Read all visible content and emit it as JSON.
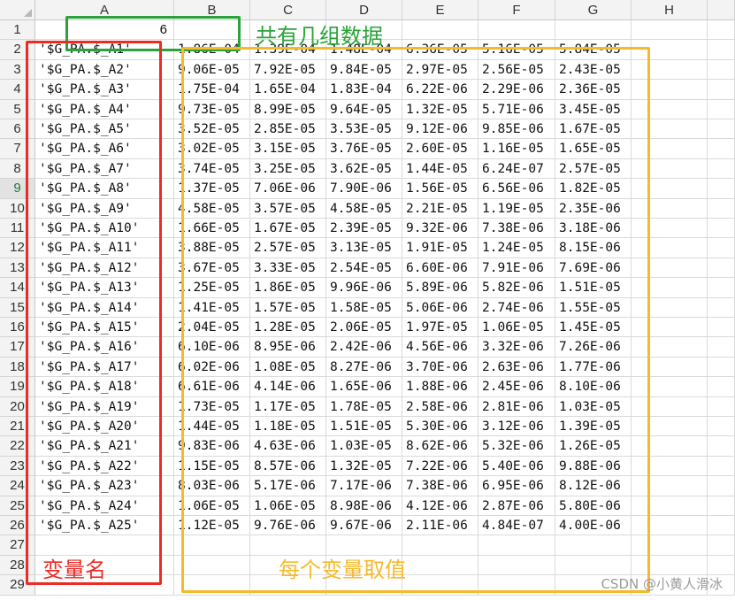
{
  "columns": [
    "A",
    "B",
    "C",
    "D",
    "E",
    "F",
    "G",
    "H"
  ],
  "rows": [
    "1",
    "2",
    "3",
    "4",
    "5",
    "6",
    "7",
    "8",
    "9",
    "10",
    "11",
    "12",
    "13",
    "14",
    "15",
    "16",
    "17",
    "18",
    "19",
    "20",
    "21",
    "22",
    "23",
    "24",
    "25",
    "26",
    "27",
    "28",
    "29"
  ],
  "selected_row": "9",
  "count_cell": "6",
  "data_rows": [
    {
      "name": "'$G_PA.$_A1'",
      "vals": [
        "1.86E-04",
        "1.39E-04",
        "1.48E-04",
        "6.36E-05",
        "5.16E-05",
        "5.84E-05"
      ]
    },
    {
      "name": "'$G_PA.$_A2'",
      "vals": [
        "9.06E-05",
        "7.92E-05",
        "9.84E-05",
        "2.97E-05",
        "2.56E-05",
        "2.43E-05"
      ]
    },
    {
      "name": "'$G_PA.$_A3'",
      "vals": [
        "1.75E-04",
        "1.65E-04",
        "1.83E-04",
        "6.22E-06",
        "2.29E-06",
        "2.36E-05"
      ]
    },
    {
      "name": "'$G_PA.$_A4'",
      "vals": [
        "9.73E-05",
        "8.99E-05",
        "9.64E-05",
        "1.32E-05",
        "5.71E-06",
        "3.45E-05"
      ]
    },
    {
      "name": "'$G_PA.$_A5'",
      "vals": [
        "3.52E-05",
        "2.85E-05",
        "3.53E-05",
        "9.12E-06",
        "9.85E-06",
        "1.67E-05"
      ]
    },
    {
      "name": "'$G_PA.$_A6'",
      "vals": [
        "3.02E-05",
        "3.15E-05",
        "3.76E-05",
        "2.60E-05",
        "1.16E-05",
        "1.65E-05"
      ]
    },
    {
      "name": "'$G_PA.$_A7'",
      "vals": [
        "3.74E-05",
        "3.25E-05",
        "3.62E-05",
        "1.44E-05",
        "6.24E-07",
        "2.57E-05"
      ]
    },
    {
      "name": "'$G_PA.$_A8'",
      "vals": [
        "1.37E-05",
        "7.06E-06",
        "7.90E-06",
        "1.56E-05",
        "6.56E-06",
        "1.82E-05"
      ]
    },
    {
      "name": "'$G_PA.$_A9'",
      "vals": [
        "4.58E-05",
        "3.57E-05",
        "4.58E-05",
        "2.21E-05",
        "1.19E-05",
        "2.35E-06"
      ]
    },
    {
      "name": "'$G_PA.$_A10'",
      "vals": [
        "1.66E-05",
        "1.67E-05",
        "2.39E-05",
        "9.32E-06",
        "7.38E-06",
        "3.18E-06"
      ]
    },
    {
      "name": "'$G_PA.$_A11'",
      "vals": [
        "3.88E-05",
        "2.57E-05",
        "3.13E-05",
        "1.91E-05",
        "1.24E-05",
        "8.15E-06"
      ]
    },
    {
      "name": "'$G_PA.$_A12'",
      "vals": [
        "3.67E-05",
        "3.33E-05",
        "2.54E-05",
        "6.60E-06",
        "7.91E-06",
        "7.69E-06"
      ]
    },
    {
      "name": "'$G_PA.$_A13'",
      "vals": [
        "1.25E-05",
        "1.86E-05",
        "9.96E-06",
        "5.89E-06",
        "5.82E-06",
        "1.51E-05"
      ]
    },
    {
      "name": "'$G_PA.$_A14'",
      "vals": [
        "1.41E-05",
        "1.57E-05",
        "1.58E-05",
        "5.06E-06",
        "2.74E-06",
        "1.55E-05"
      ]
    },
    {
      "name": "'$G_PA.$_A15'",
      "vals": [
        "2.04E-05",
        "1.28E-05",
        "2.06E-05",
        "1.97E-05",
        "1.06E-05",
        "1.45E-05"
      ]
    },
    {
      "name": "'$G_PA.$_A16'",
      "vals": [
        "6.10E-06",
        "8.95E-06",
        "2.42E-06",
        "4.56E-06",
        "3.32E-06",
        "7.26E-06"
      ]
    },
    {
      "name": "'$G_PA.$_A17'",
      "vals": [
        "6.02E-06",
        "1.08E-05",
        "8.27E-06",
        "3.70E-06",
        "2.63E-06",
        "1.77E-06"
      ]
    },
    {
      "name": "'$G_PA.$_A18'",
      "vals": [
        "6.61E-06",
        "4.14E-06",
        "1.65E-06",
        "1.88E-06",
        "2.45E-06",
        "8.10E-06"
      ]
    },
    {
      "name": "'$G_PA.$_A19'",
      "vals": [
        "1.73E-05",
        "1.17E-05",
        "1.78E-05",
        "2.58E-06",
        "2.81E-06",
        "1.03E-05"
      ]
    },
    {
      "name": "'$G_PA.$_A20'",
      "vals": [
        "1.44E-05",
        "1.18E-05",
        "1.51E-05",
        "5.30E-06",
        "3.12E-06",
        "1.39E-05"
      ]
    },
    {
      "name": "'$G_PA.$_A21'",
      "vals": [
        "9.83E-06",
        "4.63E-06",
        "1.03E-05",
        "8.62E-06",
        "5.32E-06",
        "1.26E-05"
      ]
    },
    {
      "name": "'$G_PA.$_A22'",
      "vals": [
        "1.15E-05",
        "8.57E-06",
        "1.32E-05",
        "7.22E-06",
        "5.40E-06",
        "9.88E-06"
      ]
    },
    {
      "name": "'$G_PA.$_A23'",
      "vals": [
        "8.03E-06",
        "5.17E-06",
        "7.17E-06",
        "7.38E-06",
        "6.95E-06",
        "8.12E-06"
      ]
    },
    {
      "name": "'$G_PA.$_A24'",
      "vals": [
        "1.06E-05",
        "1.06E-05",
        "8.98E-06",
        "4.12E-06",
        "2.87E-06",
        "5.80E-06"
      ]
    },
    {
      "name": "'$G_PA.$_A25'",
      "vals": [
        "1.12E-05",
        "9.76E-06",
        "9.67E-06",
        "2.11E-06",
        "4.84E-07",
        "4.00E-06"
      ]
    }
  ],
  "annotations": {
    "count_label": "共有几组数据",
    "name_label": "变量名",
    "values_label": "每个变量取值"
  },
  "colors": {
    "green": "#2aa33a",
    "red": "#ee2a24",
    "orange": "#f6b92b",
    "header_bg": "#f3f3f3",
    "selected_row_text": "#1f7a3d"
  },
  "watermark": "CSDN @小黄人滑冰"
}
